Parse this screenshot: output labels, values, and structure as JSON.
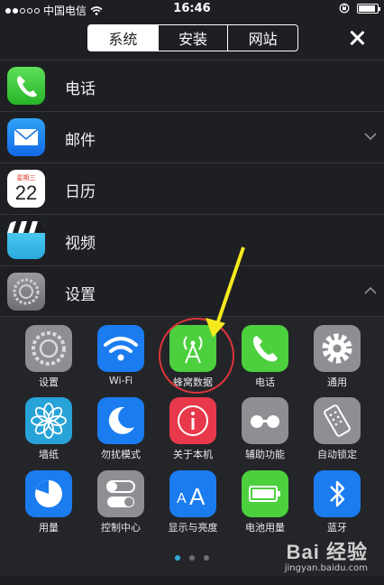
{
  "status_bar": {
    "carrier": "中国电信",
    "time": "16:46",
    "signal_dots_filled": 2,
    "signal_dots_total": 5,
    "battery_level": 0.9
  },
  "tabs": [
    {
      "label": "系统",
      "active": true
    },
    {
      "label": "安装",
      "active": false
    },
    {
      "label": "网站",
      "active": false
    }
  ],
  "apps": [
    {
      "label": "电话",
      "icon": "phone-icon",
      "chevron": ""
    },
    {
      "label": "邮件",
      "icon": "mail-icon",
      "chevron": "down"
    },
    {
      "label": "日历",
      "icon": "calendar-icon",
      "chevron": "",
      "calendar_weekday": "星期三",
      "calendar_day": "22"
    },
    {
      "label": "视频",
      "icon": "video-icon",
      "chevron": ""
    },
    {
      "label": "设置",
      "icon": "settings-icon",
      "chevron": "up"
    }
  ],
  "settings_grid": [
    {
      "label": "设置",
      "icon": "settings-icon",
      "color": "#8e8e93"
    },
    {
      "label": "Wi-Fi",
      "icon": "wifi-icon",
      "color": "#1b7cf0"
    },
    {
      "label": "蜂窝数据",
      "icon": "cellular-icon",
      "color": "#4cd03e"
    },
    {
      "label": "电话",
      "icon": "phone-icon",
      "color": "#4cd03e"
    },
    {
      "label": "通用",
      "icon": "gear-icon",
      "color": "#8e8e93"
    },
    {
      "label": "墙纸",
      "icon": "wallpaper-icon",
      "color": "#28a3d8"
    },
    {
      "label": "勿扰模式",
      "icon": "moon-icon",
      "color": "#1b7cf0"
    },
    {
      "label": "关于本机",
      "icon": "info-icon",
      "color": "#e8394b"
    },
    {
      "label": "辅助功能",
      "icon": "accessibility-icon",
      "color": "#8e8e93"
    },
    {
      "label": "自动锁定",
      "icon": "lock-remote-icon",
      "color": "#8e8e93"
    },
    {
      "label": "用量",
      "icon": "usage-pie-icon",
      "color": "#1b7cf0"
    },
    {
      "label": "控制中心",
      "icon": "toggles-icon",
      "color": "#8e8e93"
    },
    {
      "label": "显示与亮度",
      "icon": "text-size-icon",
      "color": "#1b7cf0"
    },
    {
      "label": "电池用量",
      "icon": "battery-icon",
      "color": "#4cd03e"
    },
    {
      "label": "蓝牙",
      "icon": "bluetooth-icon",
      "color": "#1b7cf0"
    }
  ],
  "pagination": {
    "pages": 3,
    "current": 1
  },
  "watermark": {
    "brand": "Bai 经验",
    "url": "jingyan.baidu.com"
  },
  "annotation_colors": {
    "arrow": "#f5ea1e",
    "circle": "#e0343a"
  }
}
